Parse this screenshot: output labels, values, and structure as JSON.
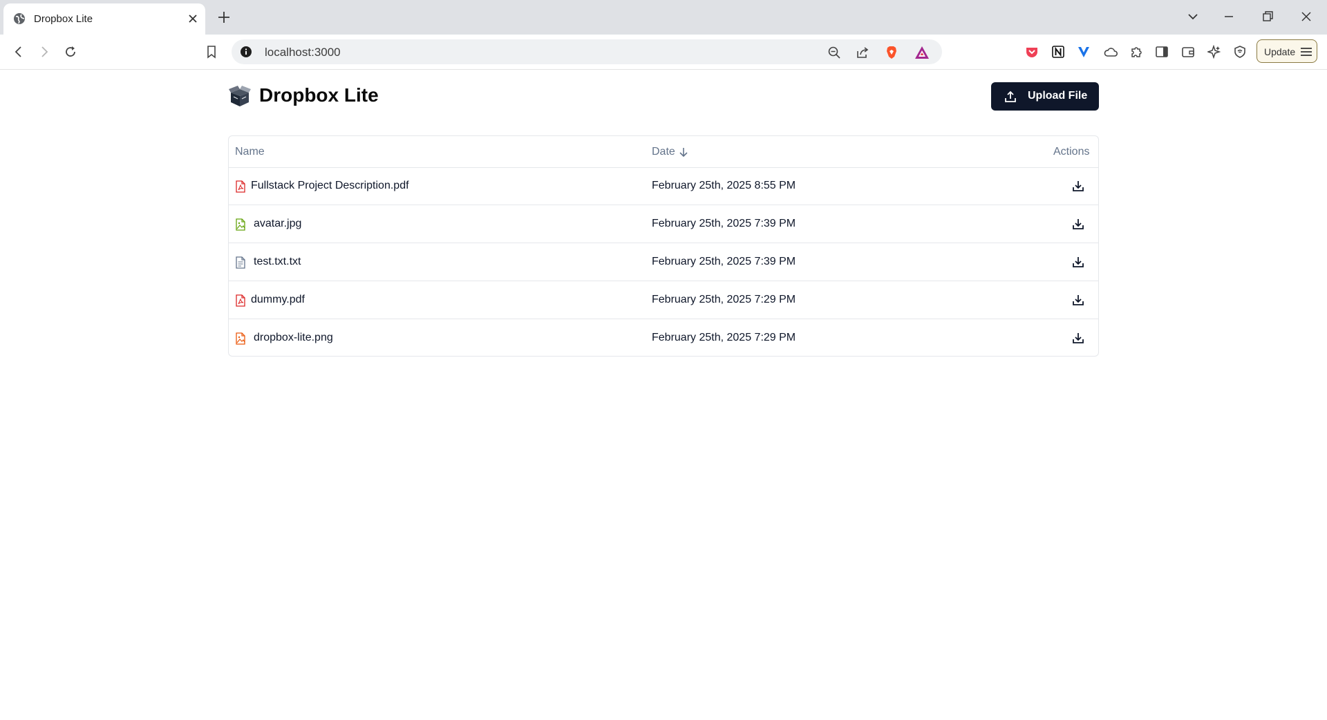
{
  "browser": {
    "tab_title": "Dropbox Lite",
    "url": "localhost:3000",
    "update_label": "Update"
  },
  "app": {
    "title": "Dropbox Lite",
    "upload_label": "Upload File"
  },
  "table": {
    "headers": {
      "name": "Name",
      "date": "Date",
      "actions": "Actions"
    },
    "sort": {
      "column": "Date",
      "direction": "descending"
    },
    "rows": [
      {
        "name": "Fullstack Project Description.pdf",
        "date": "February 25th, 2025 8:55 PM",
        "type": "pdf"
      },
      {
        "name": "avatar.jpg",
        "date": "February 25th, 2025 7:39 PM",
        "type": "image"
      },
      {
        "name": "test.txt.txt",
        "date": "February 25th, 2025 7:39 PM",
        "type": "text"
      },
      {
        "name": "dummy.pdf",
        "date": "February 25th, 2025 7:29 PM",
        "type": "pdf"
      },
      {
        "name": "dropbox-lite.png",
        "date": "February 25th, 2025 7:29 PM",
        "type": "image"
      }
    ]
  },
  "colors": {
    "primary_button": "#0f172a",
    "pdf_icon": "#dc2626",
    "image_icon_jpg": "#65a30d",
    "image_icon_png": "#ea580c",
    "text_icon": "#64748b",
    "muted_text": "#64748b"
  },
  "icons": {
    "tab_favicon": "globe-icon",
    "logo": "open-box-icon",
    "upload": "upload-icon",
    "download": "download-icon",
    "sort": "arrow-down-icon"
  }
}
